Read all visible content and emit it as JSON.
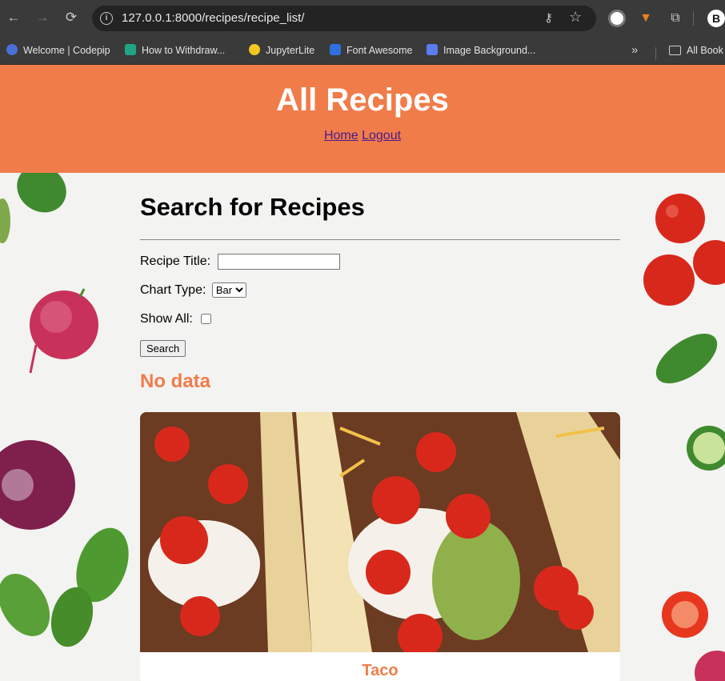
{
  "browser": {
    "url": "127.0.0.1:8000/recipes/recipe_list/",
    "bookmarks": [
      {
        "label": "Welcome | Codepip",
        "icon": "codepip-icon",
        "color": "#4a6fd6"
      },
      {
        "label": "How to Withdraw...",
        "icon": "k-logo-icon",
        "color": "#1fa583"
      },
      {
        "label": "JupyterLite",
        "icon": "jupyter-icon",
        "color": "#f3c623"
      },
      {
        "label": "Font Awesome",
        "icon": "flag-icon",
        "color": "#2f6fe0"
      },
      {
        "label": "Image Background...",
        "icon": "triangle-icon",
        "color": "#5c7cf0"
      }
    ],
    "all_bookmarks_label": "All Book"
  },
  "header": {
    "title": "All Recipes",
    "home_link": "Home",
    "logout_link": "Logout"
  },
  "search": {
    "heading": "Search for Recipes",
    "title_label": "Recipe Title:",
    "title_value": "",
    "chart_type_label": "Chart Type:",
    "chart_type_selected": "Bar",
    "show_all_label": "Show All:",
    "show_all_checked": false,
    "button_label": "Search"
  },
  "result_message": "No data",
  "recipes": [
    {
      "name": "Taco"
    }
  ],
  "colors": {
    "accent": "#f07c4a",
    "link": "#4b1a8c"
  }
}
